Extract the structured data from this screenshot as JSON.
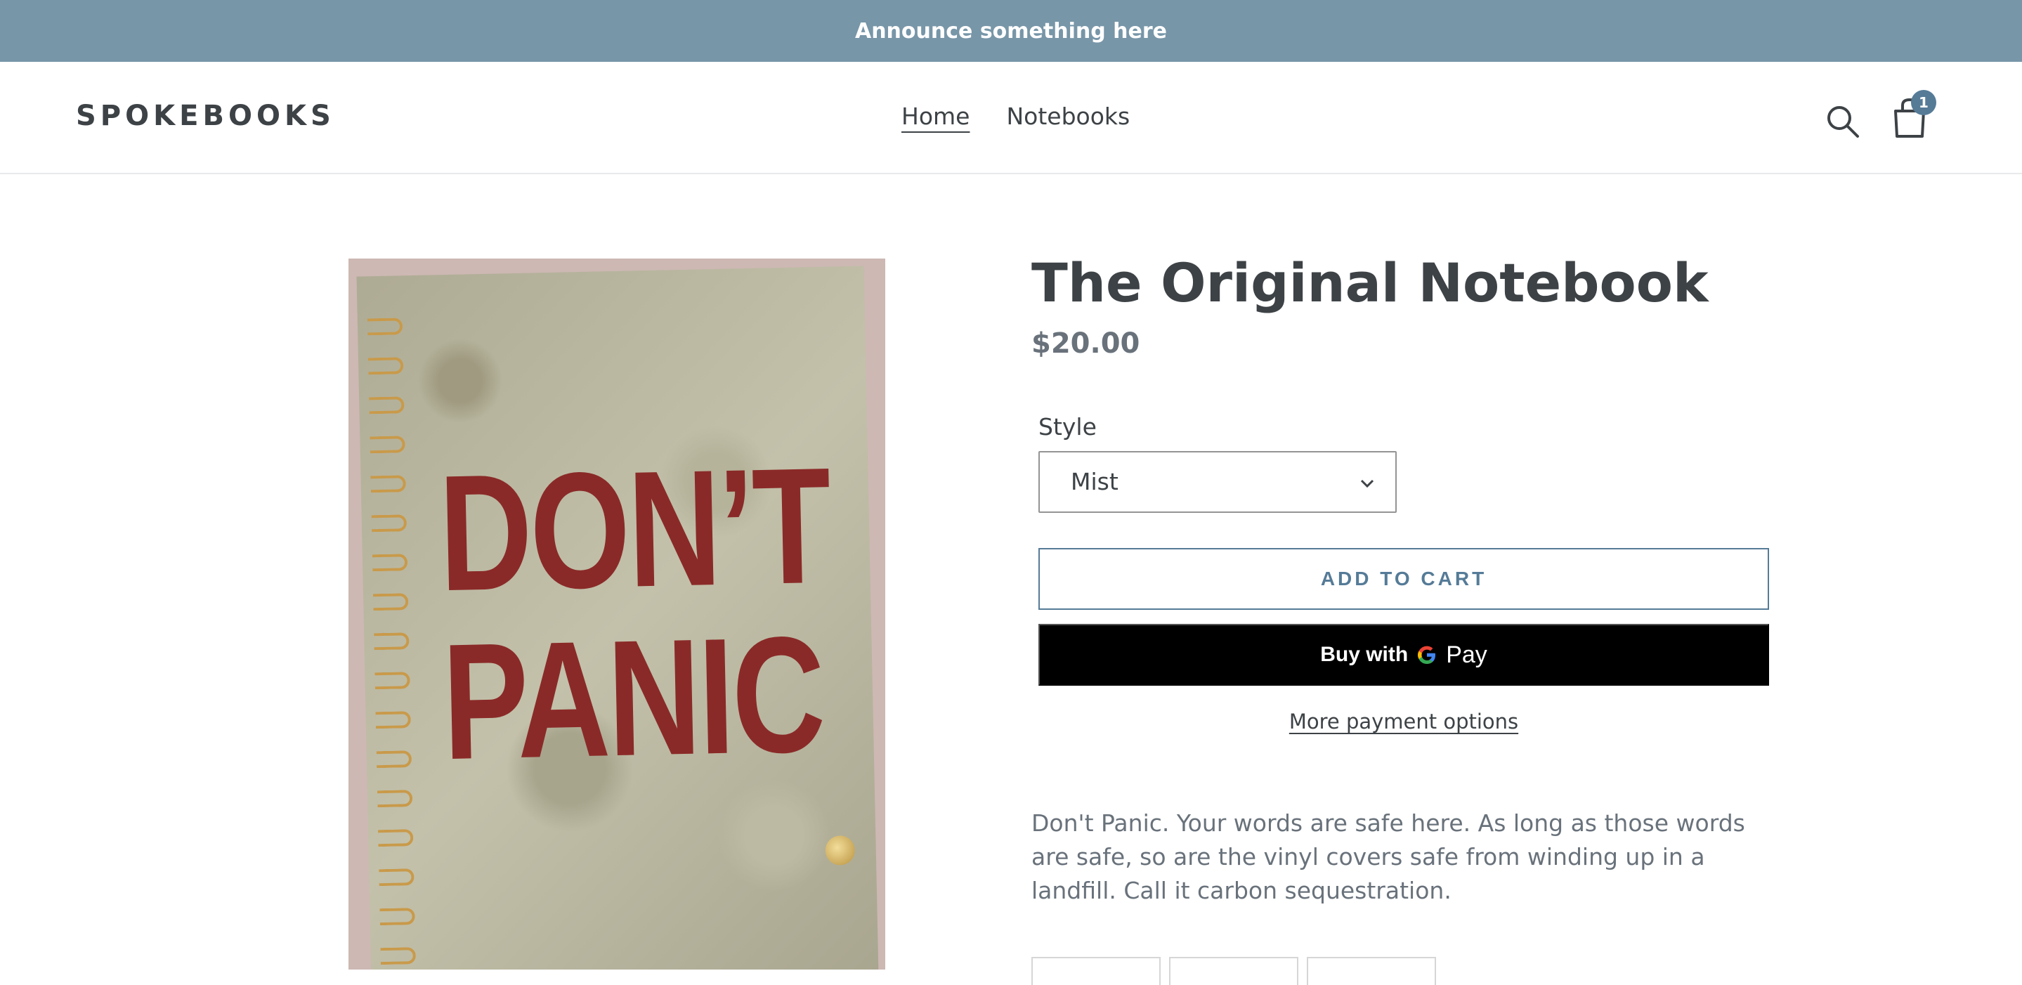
{
  "announcement": {
    "text": "Announce something here",
    "color": "#7796a8"
  },
  "header": {
    "logo": "SPOKEBOOKS",
    "nav": [
      {
        "label": "Home",
        "active": true
      },
      {
        "label": "Notebooks",
        "active": false
      }
    ],
    "icons": [
      "search-icon",
      "cart-icon"
    ],
    "cart_count": "1"
  },
  "product": {
    "image_text": {
      "line1": "DON’T",
      "line2": "PANIC"
    },
    "title": "The Original Notebook",
    "price": "$20.00",
    "style_label": "Style",
    "style_selected": "Mist",
    "add_to_cart": "ADD TO CART",
    "buy_with": "Buy with",
    "gpay_g": "G",
    "gpay_pay": "Pay",
    "more_payment_options": "More payment options",
    "description": "Don't Panic. Your words are safe here. As long as those words are safe, so are the vinyl covers safe from winding up in a landfill. Call it carbon sequestration."
  },
  "colors": {
    "accent": "#557b97",
    "text": "#3d4246",
    "muted": "#69727b"
  }
}
